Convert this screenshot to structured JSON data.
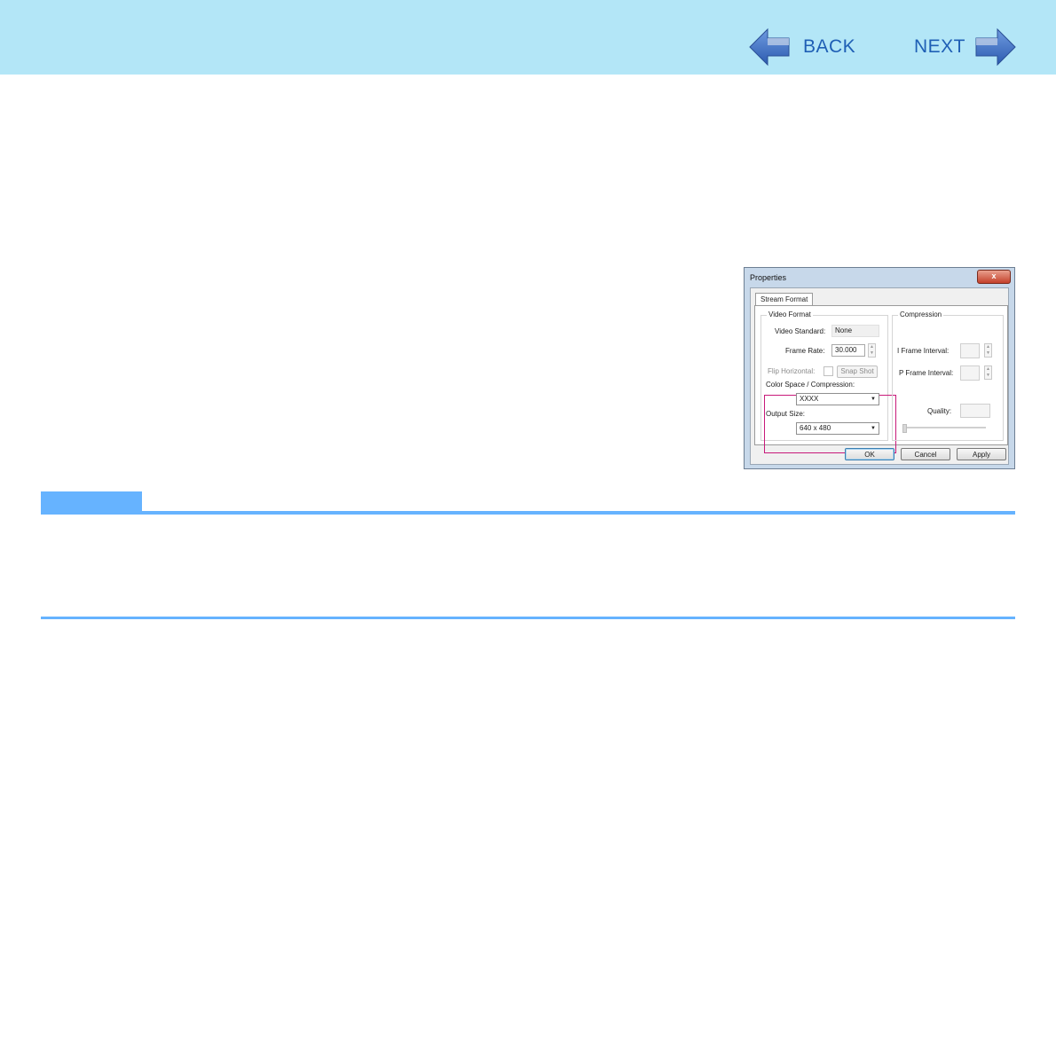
{
  "nav": {
    "back_label": "BACK",
    "next_label": "NEXT"
  },
  "colors": {
    "header_bg": "#b3e6f7",
    "nav_text": "#1f5fb5",
    "arrow_blue": "#3b6fc4",
    "note_bar": "#66b3ff",
    "highlight_box": "#c8197a"
  },
  "dialog": {
    "title": "Properties",
    "close_label": "x",
    "tab_label": "Stream Format",
    "video_format": {
      "group_label": "Video Format",
      "video_standard_label": "Video Standard:",
      "video_standard_value": "None",
      "frame_rate_label": "Frame Rate:",
      "frame_rate_value": "30.000",
      "flip_horizontal_label": "Flip Horizontal:",
      "snap_shot_label": "Snap Shot",
      "color_space_label": "Color Space / Compression:",
      "color_space_value": "XXXX",
      "output_size_label": "Output Size:",
      "output_size_value": "640 x 480"
    },
    "compression": {
      "group_label": "Compression",
      "i_frame_label": "I Frame Interval:",
      "p_frame_label": "P Frame Interval:",
      "quality_label": "Quality:"
    },
    "buttons": {
      "ok": "OK",
      "cancel": "Cancel",
      "apply": "Apply"
    }
  }
}
